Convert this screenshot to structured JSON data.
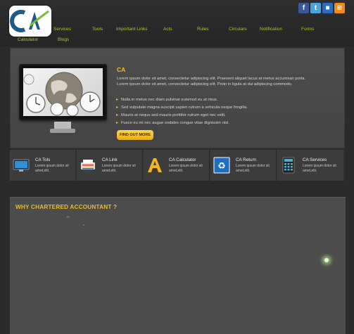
{
  "header": {
    "logo_text": "CA",
    "social": [
      {
        "name": "facebook",
        "glyph": "f"
      },
      {
        "name": "twitter",
        "glyph": "t"
      },
      {
        "name": "delicious",
        "glyph": "■"
      },
      {
        "name": "rss",
        "glyph": "≋"
      }
    ]
  },
  "nav": {
    "items": [
      "Services",
      "Tools",
      "Important Links",
      "Acts",
      "Rules",
      "Circulars",
      "Notification",
      "Forms",
      "Calculator",
      "Blogs"
    ]
  },
  "hero": {
    "title": "CA",
    "description": "Lorem ipsum dolor sit amet, consectetur adipiscing elit. Praesent aliquet lacus at metus accumsan porta. Lorem ipsum dolor sit amet, consectetur adipiscing elit. Proin in ligula at dui adipiscing commodo.",
    "bullets": [
      "Nulla in metus nec diam pulvinar euismod eu at risus.",
      "Sed vulputate magna suscipit sapien rutrum a vehicula neque fringilla.",
      "Mauris at neque sed mauris porttitor rutrum eget nec velit.",
      "Fusce eu mi nec augue sodales congue vitae dignissim nisl."
    ],
    "button_label": "FIND OUT MORE"
  },
  "services": [
    {
      "title": "CA Tols",
      "desc": "Lorem ipsum dolor sit amet,elit.",
      "icon": "monitor-icon"
    },
    {
      "title": "CA Link",
      "desc": "Lorem ipsum dolor sit amet,elit.",
      "icon": "printer-icon"
    },
    {
      "title": "CA Calculator",
      "desc": "Lorem ipsum dolor sit amet,elit.",
      "icon": "letter-a-icon"
    },
    {
      "title": "CA Return",
      "desc": "Lorem ipsum dolor sit amet,elit.",
      "icon": "recycle-icon"
    },
    {
      "title": "CA Services",
      "desc": "Lorem ipsum dolor sit amet,elit.",
      "icon": "calculator-icon"
    }
  ],
  "why": {
    "title": "WHY CHARTERED ACCOUNTANT ?"
  },
  "colors": {
    "accent_yellow": "#f4c21f",
    "nav_green": "#a3c83a",
    "background": "#2b2b2b"
  }
}
